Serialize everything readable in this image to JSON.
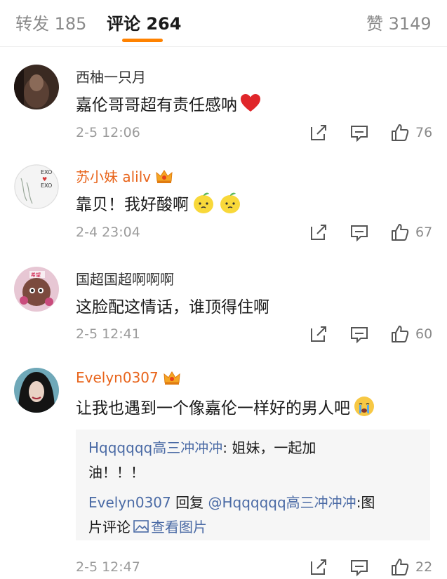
{
  "tabs": [
    {
      "label": "转发 185"
    },
    {
      "label": "评论 264"
    },
    {
      "label": "赞 3149"
    }
  ],
  "comments": [
    {
      "username": "西柚一只月",
      "text": "嘉伦哥哥超有责任感呐",
      "emoji": "heart",
      "time": "2-5 12:06",
      "likes": "76"
    },
    {
      "username": "苏小妹 alilv",
      "text": "靠贝！我好酸啊",
      "emoji": "lemon",
      "time": "2-4 23:04",
      "likes": "67",
      "avatar_text": [
        "EXO",
        "EXO"
      ]
    },
    {
      "username": "国超国超啊啊啊",
      "text": "这脸配这情话，谁顶得住啊",
      "time": "2-5 12:41",
      "likes": "60",
      "avatar_text": "希望"
    },
    {
      "username": "Evelyn0307",
      "text": "让我也遇到一个像嘉伦一样好的男人吧",
      "emoji": "crying",
      "time": "2-5 12:47",
      "likes": "22"
    }
  ],
  "reply": {
    "line1_user": "Hqqqqqq高三冲冲冲",
    "line1_text": ": 姐妹，一起加",
    "line2_text": "油！！！",
    "line3_user": "Evelyn0307",
    "line3_mid": "回复",
    "line3_mention": "@Hqqqqqq高三冲冲冲",
    "line3_text": ":图",
    "line4_text": "片评论",
    "line4_link": "查看图片"
  },
  "colors": {
    "accent": "#ff8200",
    "vip_name": "#e8641b",
    "link": "#4a6aa5",
    "reply_bg": "#f6f6f6"
  }
}
